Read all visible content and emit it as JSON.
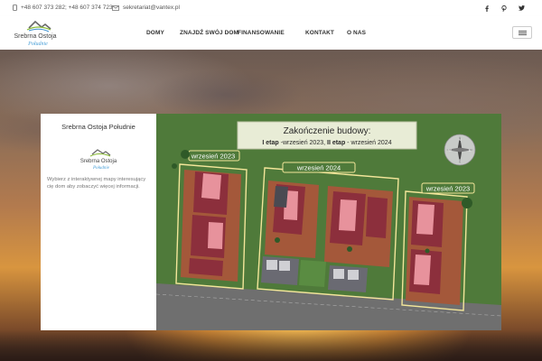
{
  "topbar": {
    "phone": "+48 607 373 282; +48 607 374 723",
    "email": "sekretariat@vantex.pl",
    "social": [
      "facebook-icon",
      "pinterest-icon",
      "twitter-icon"
    ]
  },
  "nav": {
    "items": [
      "DOMY",
      "ZNAJDŹ SWÓJ DOM",
      "FINANSOWANIE",
      "KONTAKT",
      "O NAS"
    ]
  },
  "logo": {
    "line1": "Srebrna Ostoja",
    "line2": "Południe"
  },
  "panel": {
    "title": "Srebrna Ostoja Południe",
    "description": "Wybierz z interaktywnej mapy interesujący cię dom aby zobaczyć więcej informacji."
  },
  "map": {
    "banner_title": "Zakończenie budowy:",
    "stage1": "I etap",
    "stage1_date": " -wrzesień 2023, ",
    "stage2": "II etap",
    "stage2_date": " - wrzesień 2024",
    "zone_left": "wrzesień 2023",
    "zone_middle": "wrzesień 2024",
    "zone_right": "wrzesień 2023",
    "compass": {
      "n": "N",
      "s": "S",
      "e": "E",
      "w": "W"
    }
  },
  "colors": {
    "lot_green": "#4f7a3a",
    "plot_brown": "#a4583a",
    "house_red": "#8c2f3c",
    "house_pink": "#e7929c",
    "zone_outline": "#f3e69a"
  }
}
